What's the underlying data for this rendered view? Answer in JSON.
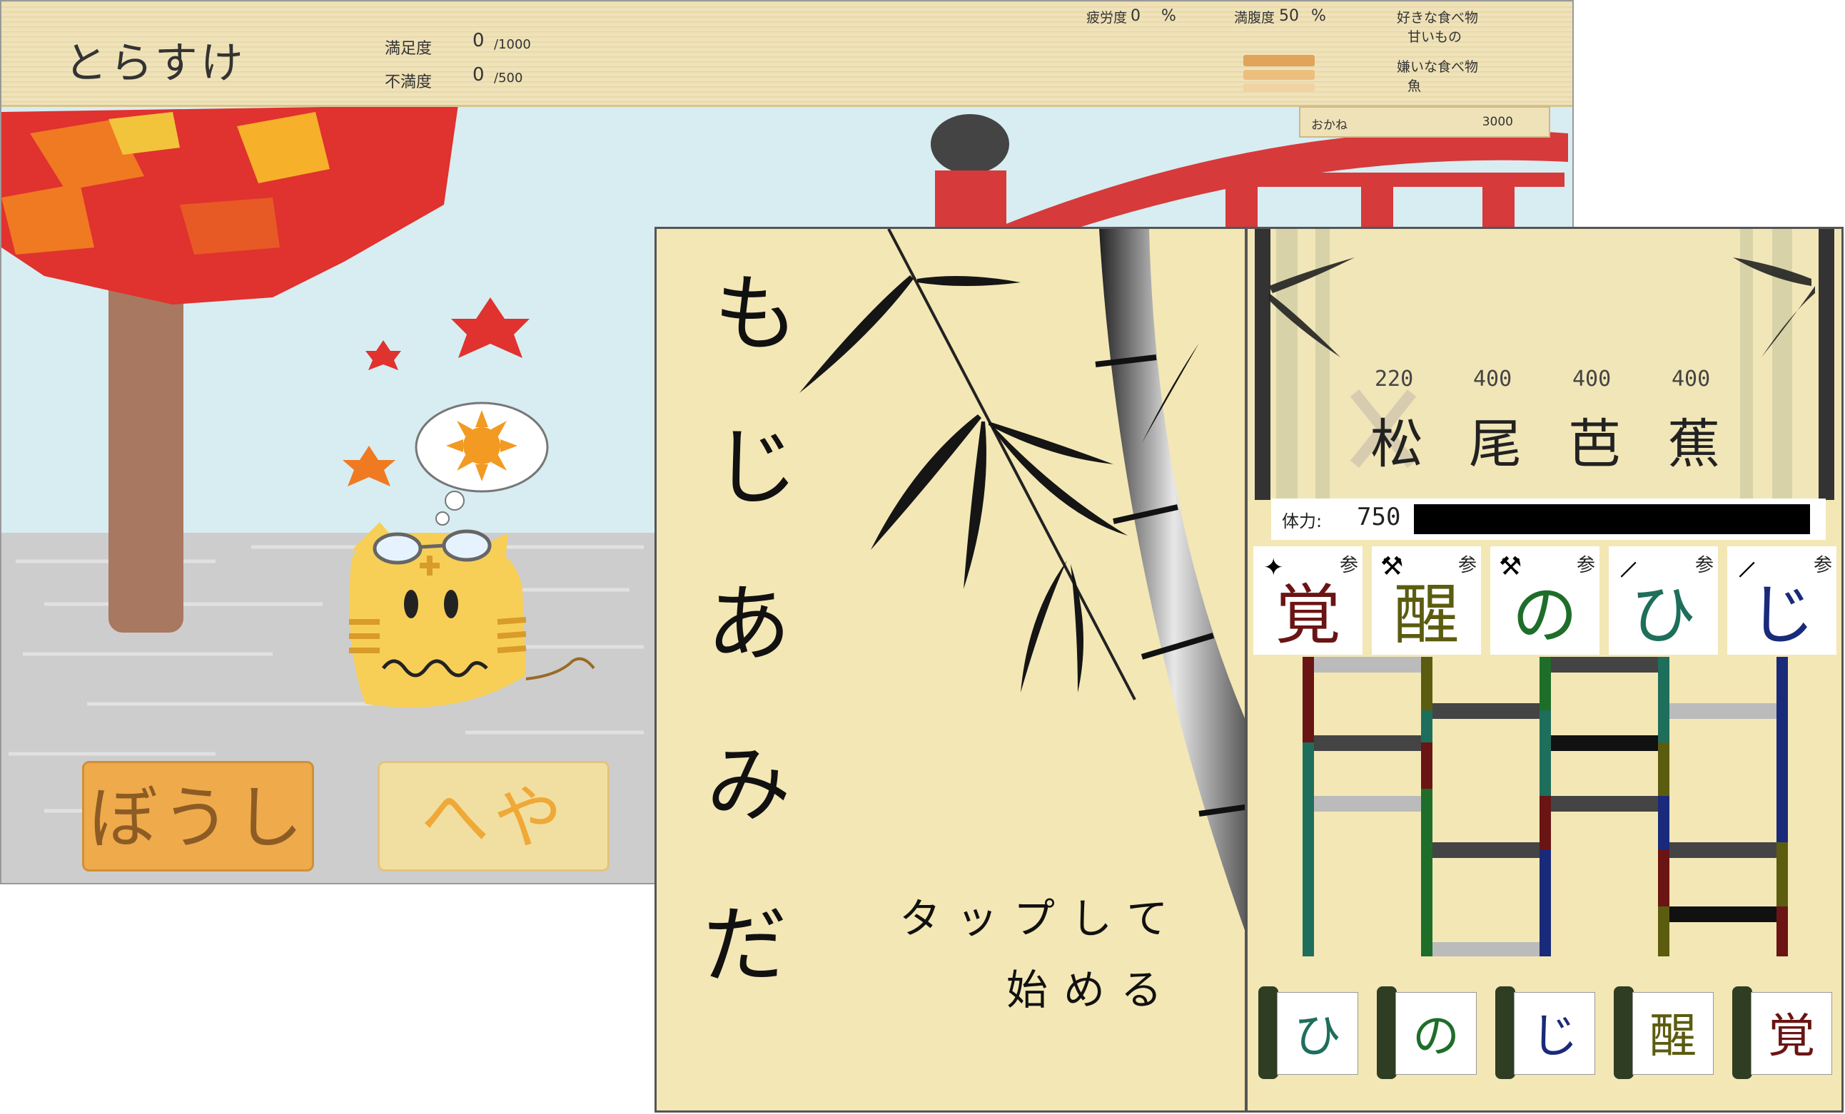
{
  "cat_game": {
    "name": "とらすけ",
    "satisfaction": {
      "label": "満足度",
      "value": "0",
      "max": "/1000"
    },
    "dissatisfaction": {
      "label": "不満度",
      "value": "0",
      "max": "/500"
    },
    "fatigue": {
      "label": "疲労度",
      "value": "0",
      "unit": "%"
    },
    "fullness": {
      "label": "満腹度",
      "value": "50",
      "unit": "%",
      "level": 0.5
    },
    "likes": {
      "label": "好きな食べ物",
      "value": "甘いもの"
    },
    "dislikes": {
      "label": "嫌いな食べ物",
      "value": "魚"
    },
    "money": {
      "label": "おかね",
      "value": "3000"
    },
    "buttons": {
      "hat": "ぼうし",
      "room": "へや"
    },
    "colors": {
      "header": "#efe2b8",
      "hat_button": "#efaa4c",
      "room_button": "#f1dfa2",
      "sky": "#d7edf2",
      "bridge": "#d63a3a",
      "cat": "#f7cf57"
    },
    "icons": [
      "maple-tree",
      "red-bridge",
      "tiger-cat",
      "thought-bubble",
      "sun-icon",
      "goggles-icon"
    ]
  },
  "title_screen": {
    "title_chars": [
      "も",
      "じ",
      "あ",
      "み",
      "だ"
    ],
    "tap_line1": "タップして",
    "tap_line2": "始める",
    "icons": [
      "bamboo-stalk",
      "bamboo-leaves"
    ]
  },
  "ladder_game": {
    "poet": [
      {
        "cost": "220",
        "char": "松",
        "crossed": true
      },
      {
        "cost": "400",
        "char": "尾",
        "crossed": false
      },
      {
        "cost": "400",
        "char": "芭",
        "crossed": false
      },
      {
        "cost": "400",
        "char": "蕉",
        "crossed": false
      }
    ],
    "hp": {
      "label": "体力:",
      "value": "750"
    },
    "cards": [
      {
        "char": "覚",
        "rank": "参",
        "weapon": "shuriken-icon",
        "color": "#6b1414"
      },
      {
        "char": "醒",
        "rank": "参",
        "weapon": "hammer-icon",
        "color": "#5c5c10"
      },
      {
        "char": "の",
        "rank": "参",
        "weapon": "hammer-icon",
        "color": "#1e6e2a"
      },
      {
        "char": "ひ",
        "rank": "参",
        "weapon": "sword-icon",
        "color": "#1e6e5c"
      },
      {
        "char": "じ",
        "rank": "参",
        "weapon": "sword-icon",
        "color": "#1a2a7a"
      }
    ],
    "scrolls": [
      {
        "char": "ひ",
        "color": "#1e6e5c"
      },
      {
        "char": "の",
        "color": "#1e6e2a"
      },
      {
        "char": "じ",
        "color": "#1a2a7a"
      },
      {
        "char": "醒",
        "color": "#5c5c10"
      },
      {
        "char": "覚",
        "color": "#6b1414"
      }
    ]
  }
}
